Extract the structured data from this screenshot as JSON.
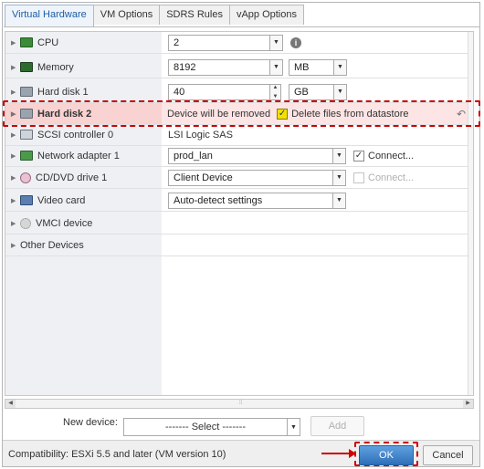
{
  "tabs": [
    {
      "label": "Virtual Hardware",
      "active": true
    },
    {
      "label": "VM Options",
      "active": false
    },
    {
      "label": "SDRS Rules",
      "active": false
    },
    {
      "label": "vApp Options",
      "active": false
    }
  ],
  "hardware": {
    "cpu": {
      "label": "CPU",
      "value": "2"
    },
    "memory": {
      "label": "Memory",
      "value": "8192",
      "unit": "MB"
    },
    "hard_disk_1": {
      "label": "Hard disk 1",
      "value": "40",
      "unit": "GB"
    },
    "hard_disk_2": {
      "label": "Hard disk 2",
      "status": "Device will be removed",
      "delete_label": "Delete files from datastore",
      "delete_checked": true
    },
    "scsi": {
      "label": "SCSI controller 0",
      "value": "LSI Logic SAS"
    },
    "network": {
      "label": "Network adapter 1",
      "value": "prod_lan",
      "connect_label": "Connect...",
      "connect_checked": true
    },
    "cdrom": {
      "label": "CD/DVD drive 1",
      "value": "Client Device",
      "connect_label": "Connect...",
      "connect_checked": false
    },
    "video": {
      "label": "Video card",
      "value": "Auto-detect settings"
    },
    "vmci": {
      "label": "VMCI device"
    },
    "other": {
      "label": "Other Devices"
    }
  },
  "new_device": {
    "label": "New device:",
    "select_value": "------- Select -------",
    "add_label": "Add"
  },
  "footer": {
    "compatibility": "Compatibility: ESXi 5.5 and later (VM version 10)",
    "ok_label": "OK",
    "cancel_label": "Cancel"
  },
  "colors": {
    "highlight_red": "#cc0000",
    "ok_blue": "#2f6fb8",
    "active_tab_text": "#1a5ea8"
  },
  "icons": {
    "info": "info-icon",
    "undo": "undo-icon"
  }
}
